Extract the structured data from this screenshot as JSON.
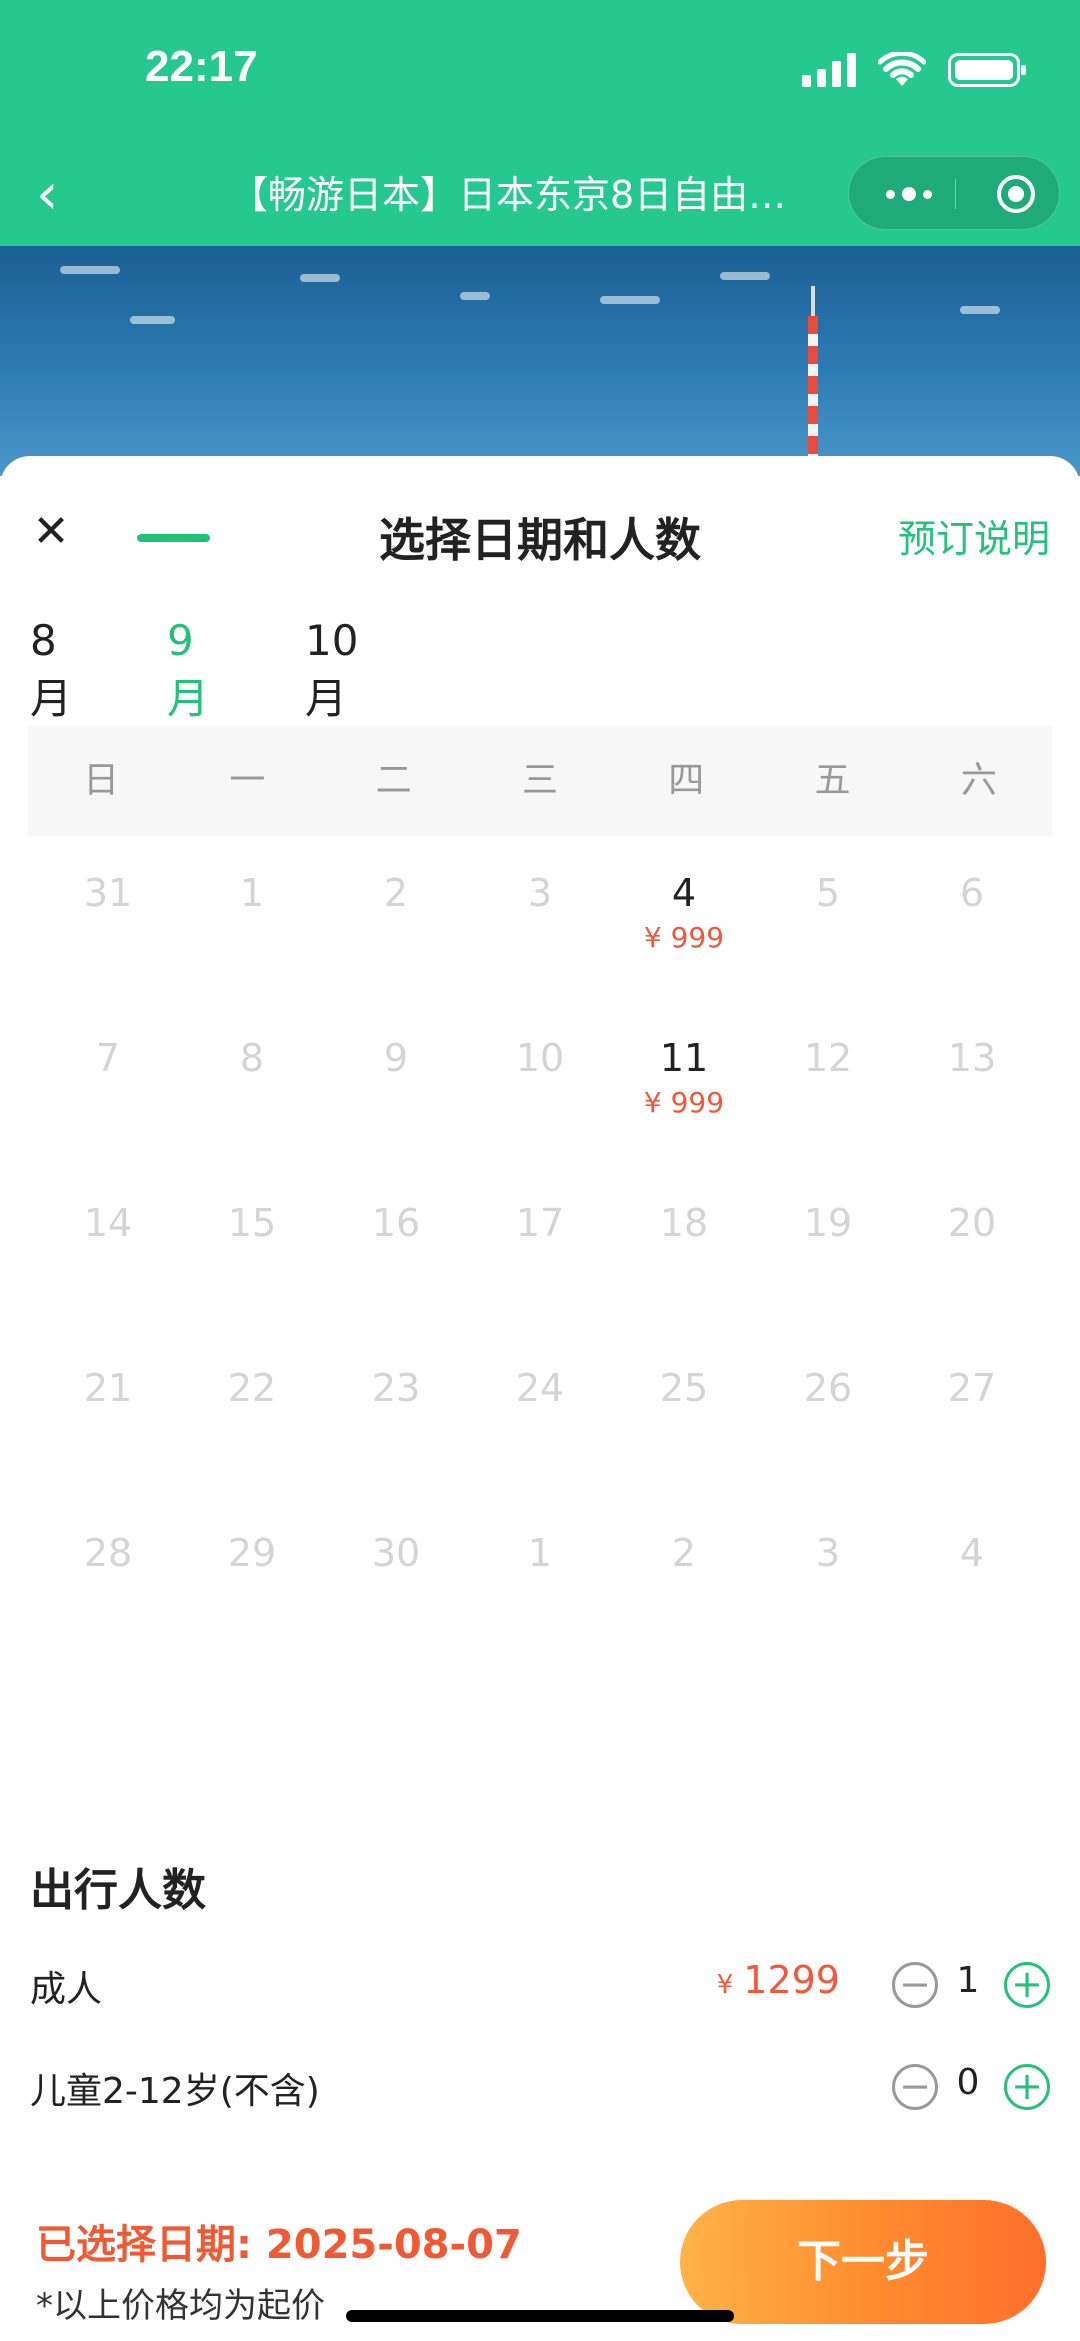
{
  "status_bar": {
    "time": "22:17"
  },
  "nav": {
    "back_icon": "chevron-left-icon",
    "title": "【畅游日本】日本东京8日自由…",
    "more_icon": "more-dots-icon",
    "target_icon": "target-icon"
  },
  "sheet": {
    "title": "选择日期和人数",
    "close_icon": "close-icon",
    "booking_note": "预订说明"
  },
  "months": [
    {
      "label": "8月",
      "active": false
    },
    {
      "label": "9月",
      "active": true
    },
    {
      "label": "10月",
      "active": false
    }
  ],
  "weekdays": [
    "日",
    "一",
    "二",
    "三",
    "四",
    "五",
    "六"
  ],
  "calendar": [
    [
      {
        "d": "31"
      },
      {
        "d": "1"
      },
      {
        "d": "2"
      },
      {
        "d": "3"
      },
      {
        "d": "4",
        "price": "¥ 999"
      },
      {
        "d": "5"
      },
      {
        "d": "6"
      }
    ],
    [
      {
        "d": "7"
      },
      {
        "d": "8"
      },
      {
        "d": "9"
      },
      {
        "d": "10"
      },
      {
        "d": "11",
        "price": "¥ 999"
      },
      {
        "d": "12"
      },
      {
        "d": "13"
      }
    ],
    [
      {
        "d": "14"
      },
      {
        "d": "15"
      },
      {
        "d": "16"
      },
      {
        "d": "17"
      },
      {
        "d": "18"
      },
      {
        "d": "19"
      },
      {
        "d": "20"
      }
    ],
    [
      {
        "d": "21"
      },
      {
        "d": "22"
      },
      {
        "d": "23"
      },
      {
        "d": "24"
      },
      {
        "d": "25"
      },
      {
        "d": "26"
      },
      {
        "d": "27"
      }
    ],
    [
      {
        "d": "28"
      },
      {
        "d": "29"
      },
      {
        "d": "30"
      },
      {
        "d": "1"
      },
      {
        "d": "2"
      },
      {
        "d": "3"
      },
      {
        "d": "4"
      }
    ]
  ],
  "travelers": {
    "title": "出行人数",
    "adult": {
      "label": "成人",
      "currency": "¥",
      "price": "1299",
      "count": "1"
    },
    "child": {
      "label": "儿童2-12岁(不含)",
      "count": "0"
    }
  },
  "footer": {
    "selected_date": "已选择日期: 2025-08-07",
    "note": "*以上价格均为起价",
    "next_label": "下一步"
  },
  "colors": {
    "brand_green": "#25c98f",
    "accent_orange": "#f0593a"
  }
}
